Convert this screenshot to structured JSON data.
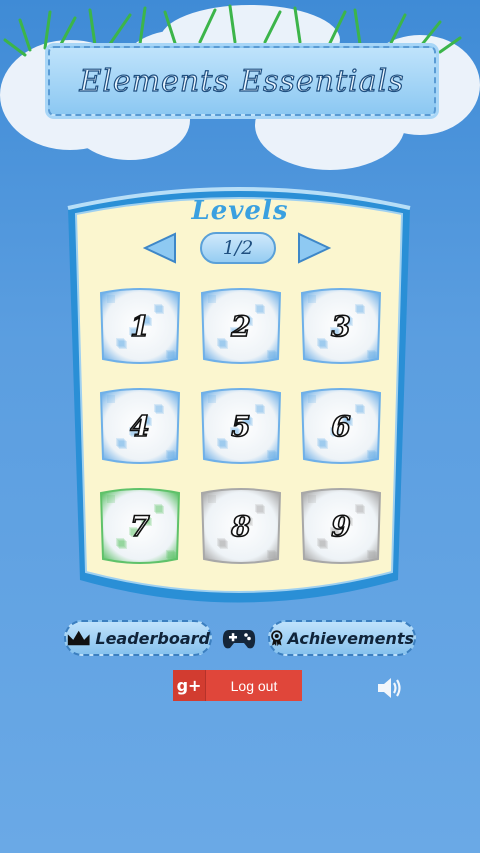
{
  "header": {
    "title": "Elements Essentials"
  },
  "levels": {
    "title": "Levels",
    "page_indicator": "1/2",
    "tiles": [
      {
        "label": "1",
        "state": "locked-blue"
      },
      {
        "label": "2",
        "state": "locked-blue"
      },
      {
        "label": "3",
        "state": "locked-blue"
      },
      {
        "label": "4",
        "state": "locked-blue"
      },
      {
        "label": "5",
        "state": "locked-blue"
      },
      {
        "label": "6",
        "state": "locked-blue"
      },
      {
        "label": "7",
        "state": "current-green"
      },
      {
        "label": "8",
        "state": "locked-gray"
      },
      {
        "label": "9",
        "state": "locked-gray"
      }
    ]
  },
  "buttons": {
    "leaderboard_label": "Leaderboard",
    "achievements_label": "Achievements",
    "logout_label": "Log out",
    "gplus_glyph": "g+"
  },
  "icons": {
    "prev": "arrow-left-icon",
    "next": "arrow-right-icon",
    "crown": "crown-icon",
    "gamepad": "gamepad-icon",
    "medal": "medal-icon",
    "sound": "speaker-icon"
  },
  "colors": {
    "tile_blue": "#6fb0e8",
    "tile_green": "#5fc26a",
    "tile_gray": "#a8a8a8",
    "panel": "#fbf6cf",
    "gplus_red": "#e0463a"
  }
}
